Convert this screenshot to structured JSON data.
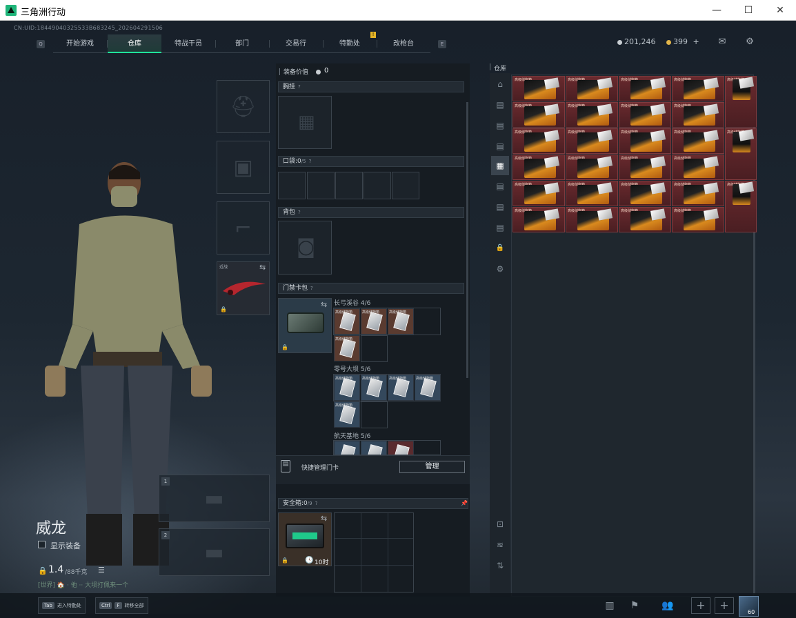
{
  "window": {
    "title": "三角洲行动",
    "minimize": "—",
    "maximize": "☐",
    "close": "✕"
  },
  "uid": "CN:UID:18449040325533B683245_202604291506",
  "nav": {
    "left_key": "Q",
    "right_key": "E",
    "tabs": [
      "开始游戏",
      "仓库",
      "特战干员",
      "部门",
      "交易行",
      "特勤处",
      "改枪台"
    ],
    "active": "仓库",
    "alert": "!"
  },
  "currency": {
    "silver": "201,246",
    "gold": "399",
    "gold_plus": "+"
  },
  "colors": {
    "accent": "#1fe39a",
    "item_red": "#6a2a2e",
    "alert": "#e4b326"
  },
  "character": {
    "name": "威龙",
    "show_gear_label": "显示装备",
    "weight": "1.4",
    "weight_max": "/88千克",
    "status_line": "[世界] 🏠 · 他 ·· 大坝打佩来一个"
  },
  "melee": {
    "label": "近战",
    "swap": "⇆"
  },
  "weapon_slots": [
    "1",
    "2"
  ],
  "loadout": {
    "value_label": "装备价值",
    "value": "0",
    "chest_rig": "胸挂",
    "pocket_label": "口袋:",
    "pocket_value": "0",
    "pocket_max": "/5",
    "backpack": "背包",
    "keycard_pack": "门禁卡包",
    "groups": [
      {
        "name": "长弓溪谷",
        "count": "4/6"
      },
      {
        "name": "零号大坝",
        "count": "5/6"
      },
      {
        "name": "航天基地",
        "count": "5/6"
      }
    ],
    "quick_manage_label": "快捷管理门卡",
    "manage_button": "管理",
    "safebox_label": "安全箱:",
    "safebox_value": "0",
    "safebox_max": "/9",
    "safebox_timer": "10时",
    "qmark": "?"
  },
  "warehouse": {
    "title": "仓库",
    "item_label": "高级储物箱",
    "item_label_alt": "高级储物箱"
  },
  "bottom": {
    "tab_key": "Tab",
    "tab_label": "进入特勤处",
    "ctrl_key": "Ctrl",
    "f_key": "F",
    "ctrl_label": "转移全部",
    "avatar_level": "60"
  },
  "icons": [
    "helmet-icon",
    "armor-icon",
    "pistol-icon",
    "knife-icon",
    "rifle-icon",
    "lock-icon",
    "mail-icon",
    "gear-icon",
    "chart-icon",
    "flag-icon",
    "friends-icon",
    "layers-icon",
    "clock-icon"
  ]
}
